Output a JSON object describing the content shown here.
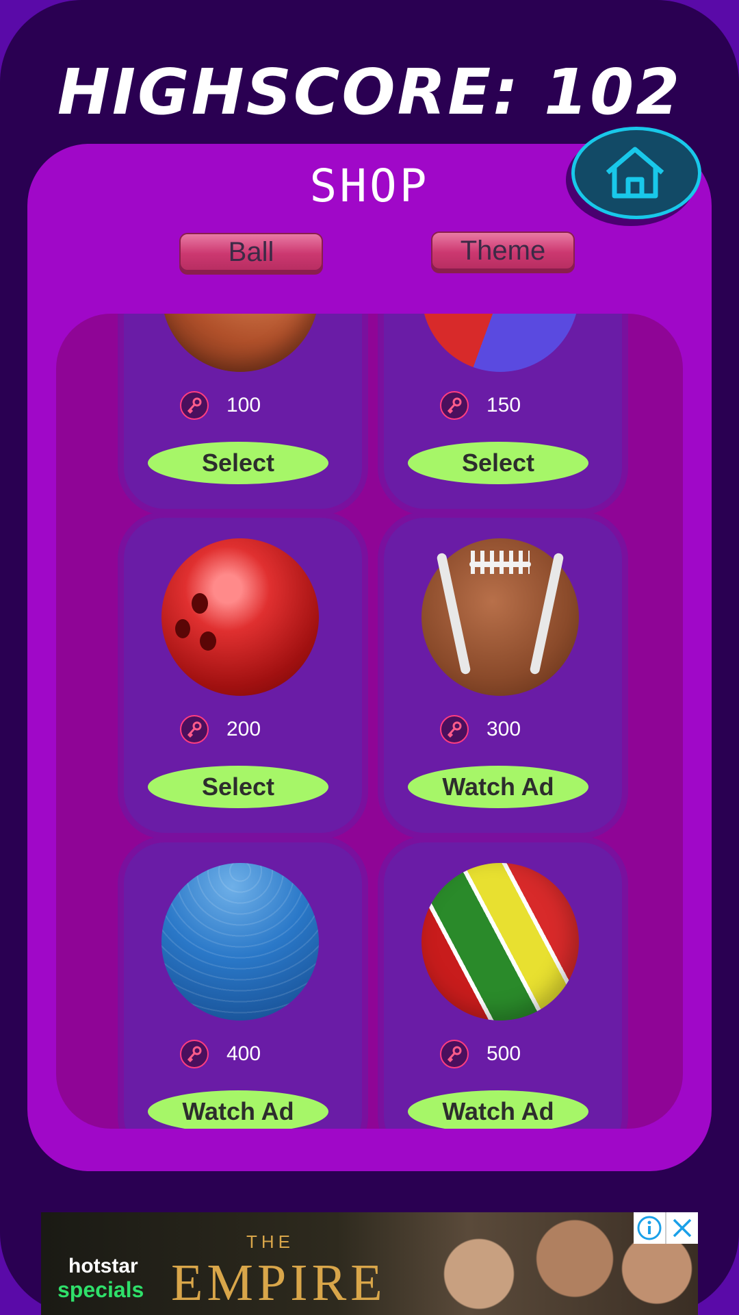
{
  "header": {
    "highscore_label": "HIGHSCORE: 102"
  },
  "shop": {
    "title": "SHOP",
    "home_icon": "home-icon",
    "tabs": [
      {
        "label": "Ball"
      },
      {
        "label": "Theme"
      }
    ],
    "currency_icon": "key-icon",
    "items": [
      {
        "price": "100",
        "action": "Select",
        "ball": "volleyball"
      },
      {
        "price": "150",
        "action": "Select",
        "ball": "beach-ball"
      },
      {
        "price": "200",
        "action": "Select",
        "ball": "bowling-ball"
      },
      {
        "price": "300",
        "action": "Watch Ad",
        "ball": "american-football"
      },
      {
        "price": "400",
        "action": "Watch Ad",
        "ball": "exercise-ball"
      },
      {
        "price": "500",
        "action": "Watch Ad",
        "ball": "striped-ball"
      }
    ]
  },
  "ad": {
    "brand_line1": "hotstar",
    "brand_line2": "specials",
    "headline_small": "THE",
    "headline": "EMPIRE",
    "info_icon": "info-icon",
    "close_icon": "close-icon"
  },
  "colors": {
    "background": "#2a0052",
    "panel": "#a008c8",
    "card": "#6a1ca6",
    "button": "#a6f668",
    "home_border": "#19c8ea"
  }
}
